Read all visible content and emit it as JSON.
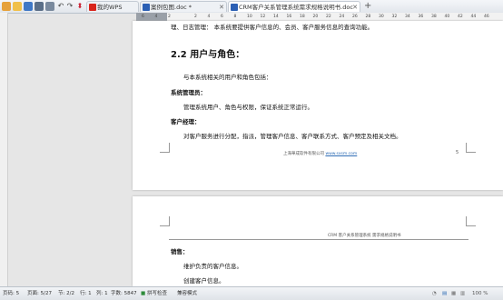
{
  "tabs": [
    {
      "label": "我的WPS",
      "active": false
    },
    {
      "label": "案例包图.doc *",
      "active": false
    },
    {
      "label": "CRM客户关系管理系统需求规格说明书.doc",
      "active": true
    }
  ],
  "ruler_numbers": [
    "6",
    "4",
    "2",
    "",
    "2",
    "4",
    "6",
    "8",
    "10",
    "12",
    "14",
    "16",
    "18",
    "20",
    "22",
    "24",
    "26",
    "28",
    "30",
    "32",
    "34",
    "36",
    "38",
    "40",
    "42",
    "44",
    "46"
  ],
  "page1": {
    "top_line": "理、日志管理：  本系统要提供客户信息的、会员、客户服务信息的查询功能。",
    "heading": "2.2  用户与角色：",
    "intro": "与本系统相关的用户和角色包括：",
    "role1_title": "系统管理员：",
    "role1_desc": "管理系统用户、角色与权限，保证系统正常运行。",
    "role2_title": "客户经理：",
    "role2_desc": "对客户服务进行分配，指派，管理客户信息、客户联系方式、客户预定及相关文档。",
    "footer_text": "上海華成软件有限公司",
    "footer_url": "www.sxsm.com",
    "page_num": "5"
  },
  "page2": {
    "header_text": "CRM 客户关系管理系统   需求规格说明书",
    "role3_title": "销售：",
    "role3_item1": "维护负责的客户信息。",
    "role3_item2": "创建客户信息。"
  },
  "status": {
    "page": "页码: 5",
    "pages": "页面: 5/27",
    "section": "节: 2/2",
    "row": "行: 1",
    "col": "列: 1",
    "words": "字数: 5847",
    "spellcheck": "拼写检查",
    "compat": "兼容模式",
    "zoom": "100 %"
  },
  "colors": {
    "accent": "#2f6db5",
    "wps_red": "#d9251c",
    "doc_blue": "#2b5fb4"
  }
}
